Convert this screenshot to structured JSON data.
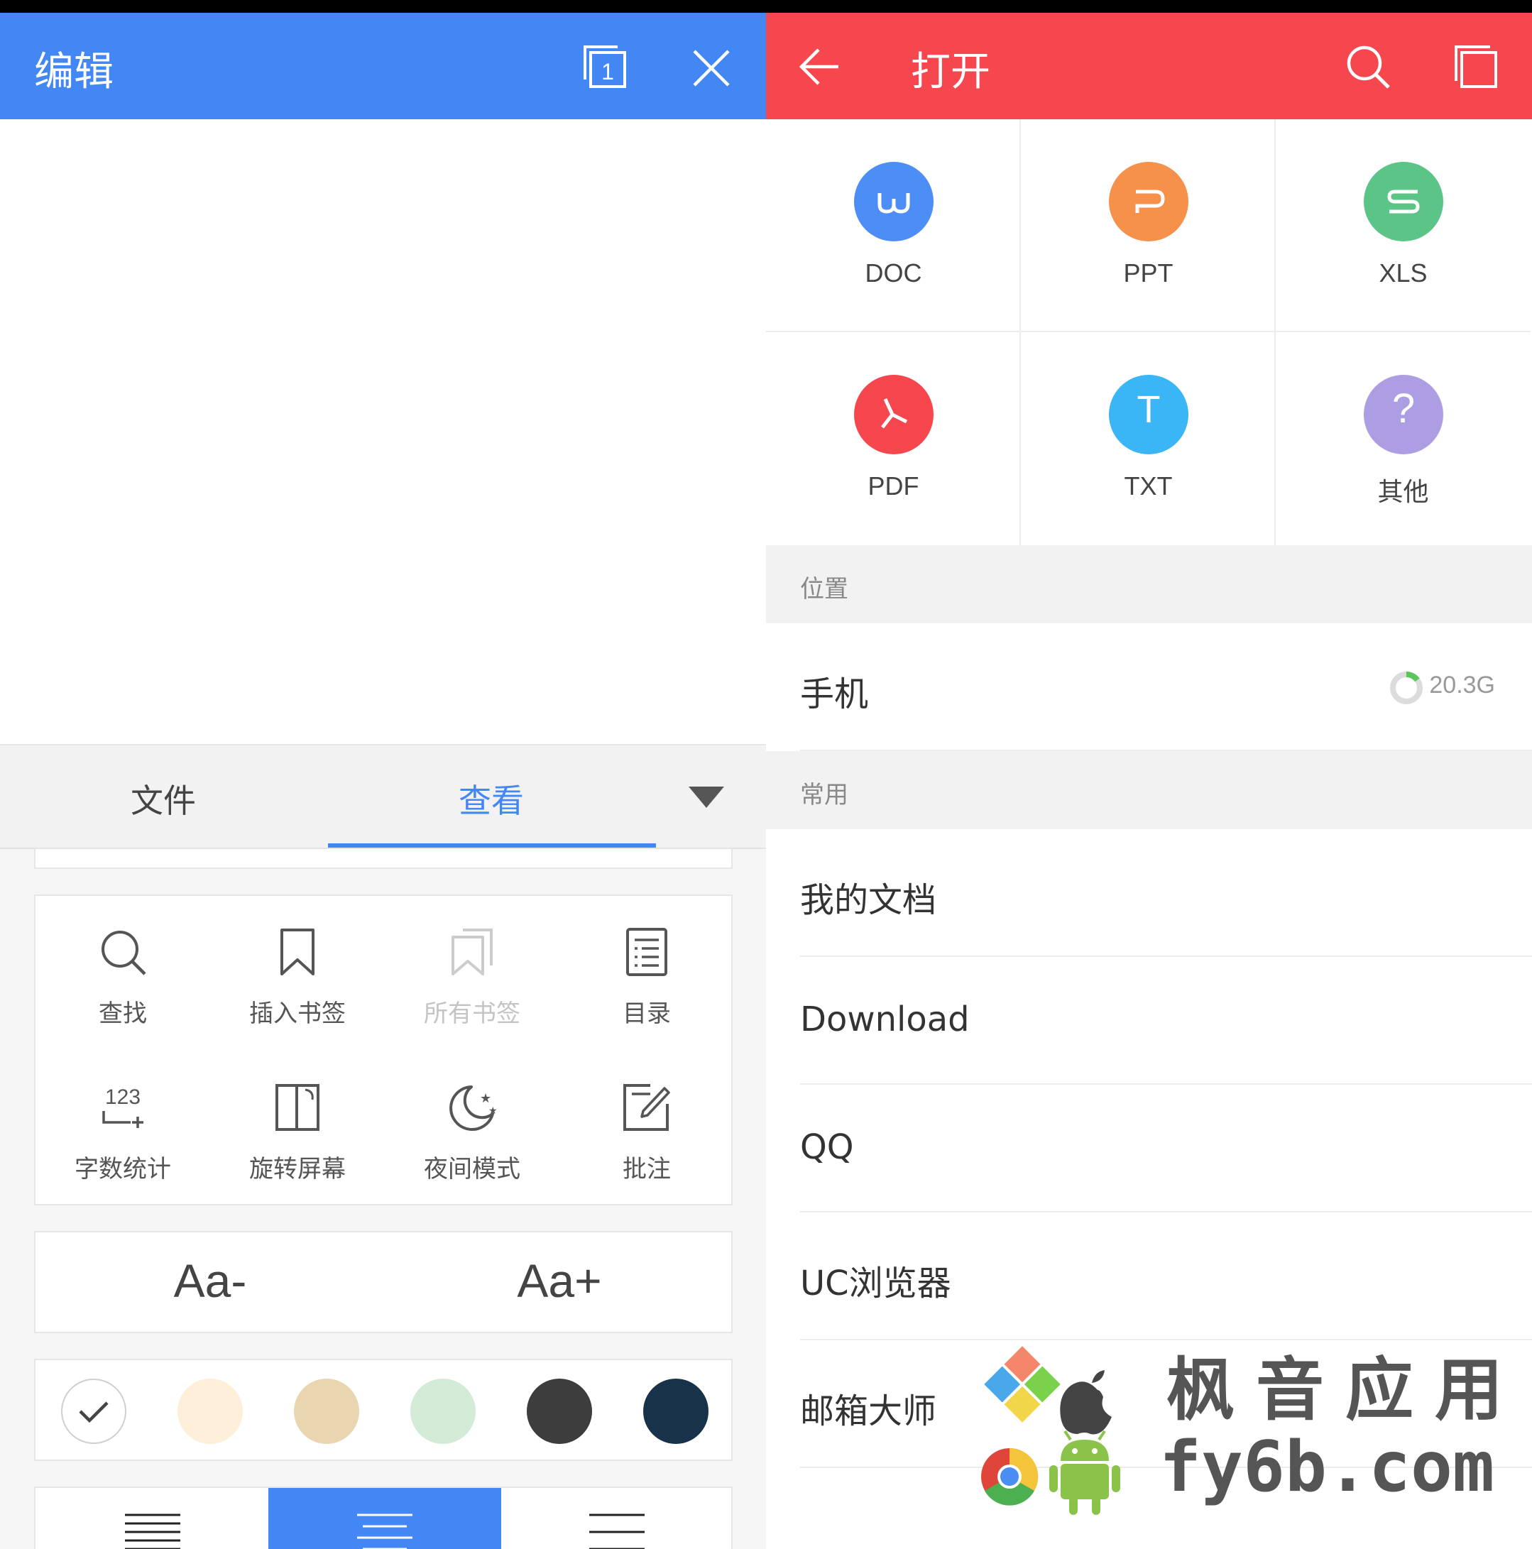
{
  "editor": {
    "title": "编辑",
    "page_badge": "1",
    "tabs": {
      "file": "文件",
      "view": "查看"
    },
    "tools": [
      {
        "label": "查找",
        "icon": "search-icon",
        "enabled": true
      },
      {
        "label": "插入书签",
        "icon": "bookmark-icon",
        "enabled": true
      },
      {
        "label": "所有书签",
        "icon": "bookmarks-icon",
        "enabled": false
      },
      {
        "label": "目录",
        "icon": "toc-icon",
        "enabled": true
      },
      {
        "label": "字数统计",
        "icon": "word-count-icon",
        "enabled": true
      },
      {
        "label": "旋转屏幕",
        "icon": "rotate-screen-icon",
        "enabled": true
      },
      {
        "label": "夜间模式",
        "icon": "night-mode-icon",
        "enabled": true
      },
      {
        "label": "批注",
        "icon": "annotate-icon",
        "enabled": true
      }
    ],
    "word_count_glyph": "123",
    "font_decrease": "Aa-",
    "font_increase": "Aa+",
    "bg_colors": [
      "#ffffff",
      "#fdefd9",
      "#ead5b1",
      "#d2ead6",
      "#3d3d3d",
      "#18324a"
    ],
    "selected_bg_index": 0,
    "selected_align_index": 1,
    "accent": "#4287f3"
  },
  "opener": {
    "title": "打开",
    "accent": "#f5474d",
    "file_types": [
      {
        "name": "DOC",
        "letter": "W",
        "color": "#4c8df6"
      },
      {
        "name": "PPT",
        "letter": "P",
        "color": "#f6914c"
      },
      {
        "name": "XLS",
        "letter": "S",
        "color": "#5ac586"
      },
      {
        "name": "PDF",
        "letter": "",
        "color": "#f5474d"
      },
      {
        "name": "TXT",
        "letter": "T",
        "color": "#3ab5f5"
      },
      {
        "name": "其他",
        "letter": "?",
        "color": "#ad9ee4"
      }
    ],
    "section_location": "位置",
    "phone": {
      "label": "手机",
      "storage": "20.3G",
      "used_fraction": 0.15
    },
    "section_common": "常用",
    "common": [
      "我的文档",
      "Download",
      "QQ",
      "UC浏览器",
      "邮箱大师"
    ]
  },
  "watermark": {
    "cn": "枫音应用",
    "url": "fy6b.com"
  }
}
